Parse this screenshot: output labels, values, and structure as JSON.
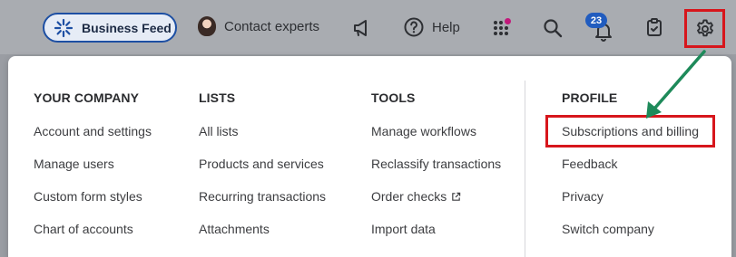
{
  "toolbar": {
    "business_feed": "Business Feed",
    "contact_experts": "Contact experts",
    "help": "Help",
    "notification_count": "23"
  },
  "menu": {
    "your_company": {
      "heading": "YOUR COMPANY",
      "items": [
        "Account and settings",
        "Manage users",
        "Custom form styles",
        "Chart of accounts"
      ]
    },
    "lists": {
      "heading": "LISTS",
      "items": [
        "All lists",
        "Products and services",
        "Recurring transactions",
        "Attachments"
      ]
    },
    "tools": {
      "heading": "TOOLS",
      "items": [
        "Manage workflows",
        "Reclassify transactions",
        "Order checks",
        "Import data"
      ]
    },
    "profile": {
      "heading": "PROFILE",
      "items": [
        "Subscriptions and billing",
        "Feedback",
        "Privacy",
        "Switch company"
      ]
    }
  },
  "annotation": {
    "highlight_color": "#d7161c",
    "arrow_color": "#1e8a5a"
  },
  "colors": {
    "brand_blue": "#1d4fa3",
    "badge_blue": "#215cbf",
    "apps_dot": "#c2187a"
  },
  "icons": [
    "sparkle-icon",
    "avatar",
    "megaphone-icon",
    "help-icon",
    "apps-grid-icon",
    "search-icon",
    "notification-bell-icon",
    "clipboard-icon",
    "gear-icon",
    "external-link-icon"
  ]
}
